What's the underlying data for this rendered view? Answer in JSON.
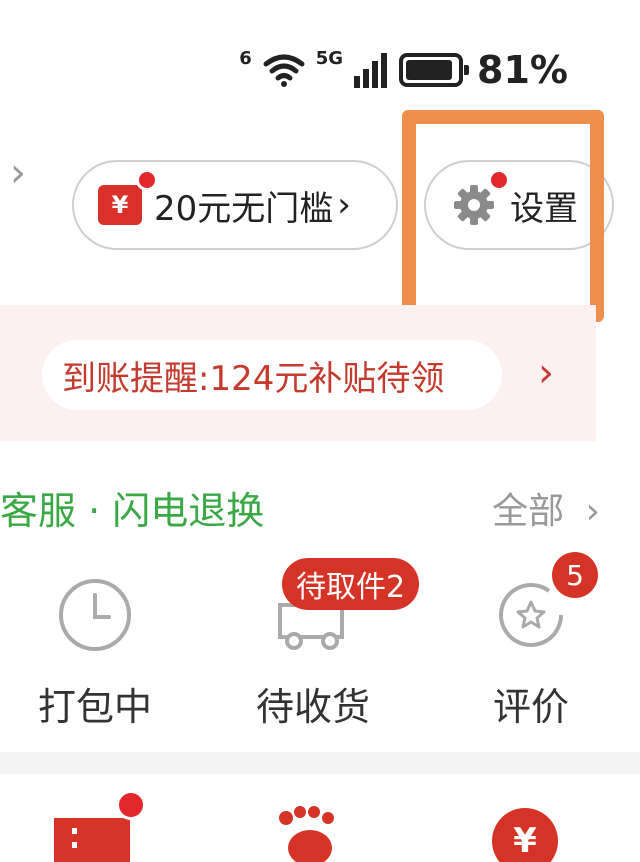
{
  "status": {
    "battery_text": "81%",
    "network": "5G",
    "wifi_sup": "6"
  },
  "header": {
    "coupon_label": "20元无门槛",
    "coupon_icon_text": "¥",
    "settings_label": "设置"
  },
  "notice": {
    "text": "到账提醒:124元补贴待领"
  },
  "orders": {
    "section_title": "客服 · 闪电退换",
    "all_label": "全部",
    "items": [
      {
        "label": "打包中"
      },
      {
        "label": "待收货",
        "badge": "待取件2"
      },
      {
        "label": "评价",
        "badge": "5"
      }
    ]
  },
  "bottom": {
    "yen": "¥"
  },
  "colors": {
    "accent": "#d63327",
    "highlight": "#ef8f4b",
    "green": "#39a845"
  }
}
